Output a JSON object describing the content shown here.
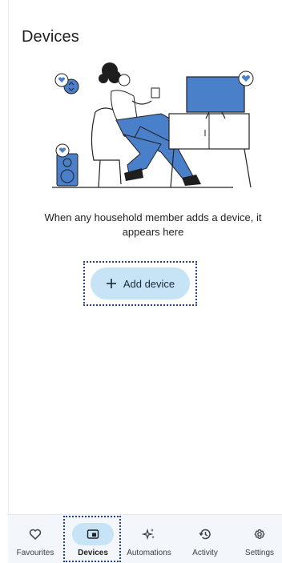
{
  "header": {
    "title": "Devices"
  },
  "empty_state": {
    "message": "When any household member adds a device, it appears here"
  },
  "actions": {
    "add_device_label": "Add device"
  },
  "bottom_nav": {
    "active": "Devices",
    "items": [
      {
        "label": "Favourites",
        "icon": "heart-icon"
      },
      {
        "label": "Devices",
        "icon": "devices-icon"
      },
      {
        "label": "Automations",
        "icon": "sparkle-icon"
      },
      {
        "label": "Activity",
        "icon": "history-icon"
      },
      {
        "label": "Settings",
        "icon": "gear-icon"
      }
    ]
  },
  "colors": {
    "accent": "#c7e4f7",
    "illustration_blue": "#4a7fc9",
    "focus_outline": "#27408b"
  }
}
